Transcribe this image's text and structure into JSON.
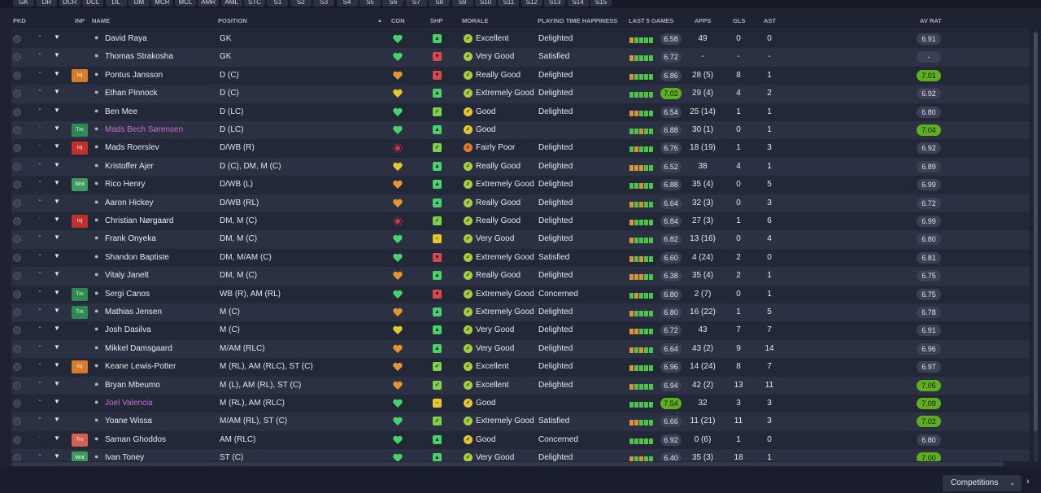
{
  "tabs": [
    "GK",
    "DR",
    "DCR",
    "DCL",
    "DL",
    "DM",
    "MCR",
    "MCL",
    "AMR",
    "AML",
    "STC",
    "S1",
    "S2",
    "S3",
    "S4",
    "S5",
    "S6",
    "S7",
    "S8",
    "S9",
    "S10",
    "S11",
    "S12",
    "S13",
    "S14",
    "S15"
  ],
  "columns": {
    "pkd": "PKD",
    "inf": "INF",
    "name": "NAME",
    "position": "POSITION",
    "con": "CON",
    "shp": "SHP",
    "morale": "MORALE",
    "happiness": "PLAYING TIME HAPPINESS",
    "last5": "LAST 5 GAMES",
    "apps": "APPS",
    "gls": "GLS",
    "ast": "AST",
    "avrat": "AV RAT"
  },
  "sort_icon": "sort-ascending-icon",
  "colors": {
    "row_odd": "#232839",
    "row_even": "#2b3042",
    "good_rating": "#5fae1e",
    "con_green": "#47d26a",
    "con_orange": "#e3962d",
    "con_yellow": "#e6c72c",
    "con_red": "#d03a3a",
    "morale_green": "#a3d33a",
    "morale_yellow": "#e6c72c",
    "morale_orange": "#e57a2c"
  },
  "players": [
    {
      "dash": "-",
      "dash_red": false,
      "inf": "",
      "inf_type": "",
      "name": "David Raya",
      "pink": false,
      "position": "GK",
      "con": "green",
      "shp": "up",
      "morale": "Excellent",
      "morale_level": "green",
      "happiness": "Delighted",
      "form": [
        "o",
        "g",
        "g",
        "g",
        "g"
      ],
      "last5": "6.58",
      "l5_good": false,
      "apps": "49",
      "gls": "0",
      "ast": "0",
      "avrat": "6.91",
      "av_good": false
    },
    {
      "dash": "-",
      "dash_red": false,
      "inf": "",
      "inf_type": "",
      "name": "Thomas Strakosha",
      "pink": false,
      "position": "GK",
      "con": "green",
      "shp": "down",
      "morale": "Very Good",
      "morale_level": "green",
      "happiness": "Satisfied",
      "form": [
        "o",
        "g",
        "g",
        "g",
        "g"
      ],
      "last5": "6.72",
      "l5_good": false,
      "apps": "-",
      "gls": "-",
      "ast": "-",
      "avrat": "-",
      "av_good": false
    },
    {
      "dash": "-",
      "dash_red": false,
      "inf": "Inj",
      "inf_type": "orange",
      "name": "Pontus Jansson",
      "pink": false,
      "position": "D (C)",
      "con": "orange",
      "shp": "down",
      "morale": "Really Good",
      "morale_level": "green",
      "happiness": "Delighted",
      "form": [
        "o",
        "g",
        "g",
        "g",
        "g"
      ],
      "last5": "6.86",
      "l5_good": false,
      "apps": "28 (5)",
      "gls": "8",
      "ast": "1",
      "avrat": "7.01",
      "av_good": true
    },
    {
      "dash": "-",
      "dash_red": false,
      "inf": "",
      "inf_type": "",
      "name": "Ethan Pinnock",
      "pink": false,
      "position": "D (C)",
      "con": "yellow",
      "shp": "up",
      "morale": "Extremely Good",
      "morale_level": "green",
      "happiness": "Delighted",
      "form": [
        "g",
        "g",
        "g",
        "g",
        "g"
      ],
      "last5": "7.02",
      "l5_good": true,
      "apps": "29 (4)",
      "gls": "4",
      "ast": "2",
      "avrat": "6.92",
      "av_good": false
    },
    {
      "dash": "-",
      "dash_red": false,
      "inf": "",
      "inf_type": "",
      "name": "Ben Mee",
      "pink": false,
      "position": "D (LC)",
      "con": "green",
      "shp": "check",
      "morale": "Good",
      "morale_level": "yellow",
      "happiness": "Delighted",
      "form": [
        "o",
        "o",
        "g",
        "g",
        "g"
      ],
      "last5": "6.54",
      "l5_good": false,
      "apps": "25 (14)",
      "gls": "1",
      "ast": "1",
      "avrat": "6.80",
      "av_good": false
    },
    {
      "dash": "-",
      "dash_red": true,
      "inf": "Tm",
      "inf_type": "tm",
      "name": "Mads Bech Sørensen",
      "pink": true,
      "position": "D (LC)",
      "con": "green",
      "shp": "up",
      "morale": "Good",
      "morale_level": "yellow",
      "happiness": "",
      "form": [
        "g",
        "g",
        "o",
        "g",
        "g"
      ],
      "last5": "6.88",
      "l5_good": false,
      "apps": "30 (1)",
      "gls": "0",
      "ast": "1",
      "avrat": "7.04",
      "av_good": true
    },
    {
      "dash": "-",
      "dash_red": true,
      "inf": "Inj",
      "inf_type": "inj",
      "name": "Mads Roerslev",
      "pink": false,
      "position": "D/WB (R)",
      "con": "red",
      "shp": "check",
      "morale": "Fairly Poor",
      "morale_level": "orange",
      "happiness": "Delighted",
      "form": [
        "g",
        "o",
        "g",
        "g",
        "g"
      ],
      "last5": "6.76",
      "l5_good": false,
      "apps": "18 (19)",
      "gls": "1",
      "ast": "3",
      "avrat": "6.92",
      "av_good": false
    },
    {
      "dash": "-",
      "dash_red": false,
      "inf": "",
      "inf_type": "",
      "name": "Kristoffer Ajer",
      "pink": false,
      "position": "D (C), DM, M (C)",
      "con": "yellow",
      "shp": "up",
      "morale": "Really Good",
      "morale_level": "green",
      "happiness": "Delighted",
      "form": [
        "o",
        "o",
        "o",
        "g",
        "g"
      ],
      "last5": "6.52",
      "l5_good": false,
      "apps": "38",
      "gls": "4",
      "ast": "1",
      "avrat": "6.89",
      "av_good": false
    },
    {
      "dash": "-",
      "dash_red": false,
      "inf": "Wnt",
      "inf_type": "wnt",
      "name": "Rico Henry",
      "pink": false,
      "position": "D/WB (L)",
      "con": "orange",
      "shp": "up",
      "morale": "Extremely Good",
      "morale_level": "green",
      "happiness": "Delighted",
      "form": [
        "g",
        "g",
        "o",
        "g",
        "g"
      ],
      "last5": "6.88",
      "l5_good": false,
      "apps": "35 (4)",
      "gls": "0",
      "ast": "5",
      "avrat": "6.99",
      "av_good": false
    },
    {
      "dash": "-",
      "dash_red": false,
      "inf": "",
      "inf_type": "",
      "name": "Aaron Hickey",
      "pink": false,
      "position": "D/WB (RL)",
      "con": "orange",
      "shp": "up",
      "morale": "Really Good",
      "morale_level": "green",
      "happiness": "Delighted",
      "form": [
        "o",
        "g",
        "o",
        "g",
        "g"
      ],
      "last5": "6.64",
      "l5_good": false,
      "apps": "32 (3)",
      "gls": "0",
      "ast": "3",
      "avrat": "6.72",
      "av_good": false
    },
    {
      "dash": "-",
      "dash_red": true,
      "inf": "Inj",
      "inf_type": "inj",
      "name": "Christian Nørgaard",
      "pink": false,
      "position": "DM, M (C)",
      "con": "red",
      "shp": "check",
      "morale": "Really Good",
      "morale_level": "green",
      "happiness": "Delighted",
      "form": [
        "o",
        "g",
        "g",
        "g",
        "g"
      ],
      "last5": "6.84",
      "l5_good": false,
      "apps": "27 (3)",
      "gls": "1",
      "ast": "6",
      "avrat": "6.99",
      "av_good": false
    },
    {
      "dash": "-",
      "dash_red": false,
      "inf": "",
      "inf_type": "",
      "name": "Frank Onyeka",
      "pink": false,
      "position": "DM, M (C)",
      "con": "green",
      "shp": "dash",
      "morale": "Very Good",
      "morale_level": "green",
      "happiness": "Delighted",
      "form": [
        "o",
        "g",
        "g",
        "g",
        "g"
      ],
      "last5": "6.82",
      "l5_good": false,
      "apps": "13 (16)",
      "gls": "0",
      "ast": "4",
      "avrat": "6.80",
      "av_good": false
    },
    {
      "dash": "-",
      "dash_red": false,
      "inf": "",
      "inf_type": "",
      "name": "Shandon Baptiste",
      "pink": false,
      "position": "DM, M/AM (C)",
      "con": "green",
      "shp": "down",
      "morale": "Extremely Good",
      "morale_level": "green",
      "happiness": "Satisfied",
      "form": [
        "o",
        "g",
        "o",
        "g",
        "g"
      ],
      "last5": "6.60",
      "l5_good": false,
      "apps": "4 (24)",
      "gls": "2",
      "ast": "0",
      "avrat": "6.81",
      "av_good": false
    },
    {
      "dash": "-",
      "dash_red": false,
      "inf": "",
      "inf_type": "",
      "name": "Vitaly Janelt",
      "pink": false,
      "position": "DM, M (C)",
      "con": "orange",
      "shp": "up",
      "morale": "Really Good",
      "morale_level": "green",
      "happiness": "Delighted",
      "form": [
        "o",
        "o",
        "o",
        "g",
        "g"
      ],
      "last5": "6.38",
      "l5_good": false,
      "apps": "35 (4)",
      "gls": "2",
      "ast": "1",
      "avrat": "6.75",
      "av_good": false
    },
    {
      "dash": "-",
      "dash_red": false,
      "inf": "Tm",
      "inf_type": "tm",
      "name": "Sergi Canos",
      "pink": false,
      "position": "WB (R), AM (RL)",
      "con": "green",
      "shp": "down",
      "morale": "Extremely Good",
      "morale_level": "green",
      "happiness": "Concerned",
      "form": [
        "g",
        "o",
        "g",
        "g",
        "g"
      ],
      "last5": "6.80",
      "l5_good": false,
      "apps": "2 (7)",
      "gls": "0",
      "ast": "1",
      "avrat": "6.75",
      "av_good": false
    },
    {
      "dash": "-",
      "dash_red": false,
      "inf": "Tm",
      "inf_type": "tm",
      "name": "Mathias Jensen",
      "pink": false,
      "position": "M (C)",
      "con": "orange",
      "shp": "up",
      "morale": "Extremely Good",
      "morale_level": "green",
      "happiness": "Delighted",
      "form": [
        "o",
        "g",
        "g",
        "g",
        "g"
      ],
      "last5": "6.80",
      "l5_good": false,
      "apps": "16 (22)",
      "gls": "1",
      "ast": "5",
      "avrat": "6.78",
      "av_good": false
    },
    {
      "dash": "-",
      "dash_red": false,
      "inf": "",
      "inf_type": "",
      "name": "Josh Dasilva",
      "pink": false,
      "position": "M (C)",
      "con": "yellow",
      "shp": "up",
      "morale": "Very Good",
      "morale_level": "green",
      "happiness": "Delighted",
      "form": [
        "o",
        "o",
        "g",
        "g",
        "g"
      ],
      "last5": "6.72",
      "l5_good": false,
      "apps": "43",
      "gls": "7",
      "ast": "7",
      "avrat": "6.91",
      "av_good": false
    },
    {
      "dash": "-",
      "dash_red": false,
      "inf": "",
      "inf_type": "",
      "name": "Mikkel Damsgaard",
      "pink": false,
      "position": "M/AM (RLC)",
      "con": "orange",
      "shp": "up",
      "morale": "Very Good",
      "morale_level": "green",
      "happiness": "Delighted",
      "form": [
        "o",
        "g",
        "o",
        "g",
        "g"
      ],
      "last5": "6.64",
      "l5_good": false,
      "apps": "43 (2)",
      "gls": "9",
      "ast": "14",
      "avrat": "6.96",
      "av_good": false
    },
    {
      "dash": "-",
      "dash_red": false,
      "inf": "Inj",
      "inf_type": "orange",
      "name": "Keane Lewis-Potter",
      "pink": false,
      "position": "M (RL), AM (RLC), ST (C)",
      "con": "orange",
      "shp": "check",
      "morale": "Excellent",
      "morale_level": "green",
      "happiness": "Delighted",
      "form": [
        "o",
        "g",
        "g",
        "g",
        "g"
      ],
      "last5": "6.96",
      "l5_good": false,
      "apps": "14 (24)",
      "gls": "8",
      "ast": "7",
      "avrat": "6.97",
      "av_good": false
    },
    {
      "dash": "-",
      "dash_red": false,
      "inf": "",
      "inf_type": "",
      "name": "Bryan Mbeumo",
      "pink": false,
      "position": "M (L), AM (RL), ST (C)",
      "con": "orange",
      "shp": "check",
      "morale": "Excellent",
      "morale_level": "green",
      "happiness": "Delighted",
      "form": [
        "o",
        "g",
        "g",
        "g",
        "g"
      ],
      "last5": "6.94",
      "l5_good": false,
      "apps": "42 (2)",
      "gls": "13",
      "ast": "11",
      "avrat": "7.05",
      "av_good": true
    },
    {
      "dash": "-",
      "dash_red": false,
      "inf": "",
      "inf_type": "",
      "name": "Joel Valencia",
      "pink": true,
      "position": "M (RL), AM (RLC)",
      "con": "green",
      "shp": "dash",
      "morale": "Good",
      "morale_level": "yellow",
      "happiness": "",
      "form": [
        "g",
        "g",
        "g",
        "g",
        "g"
      ],
      "last5": "7.54",
      "l5_good": true,
      "apps": "32",
      "gls": "3",
      "ast": "3",
      "avrat": "7.09",
      "av_good": true
    },
    {
      "dash": "-",
      "dash_red": false,
      "inf": "",
      "inf_type": "",
      "name": "Yoane Wissa",
      "pink": false,
      "position": "M/AM (RL), ST (C)",
      "con": "green",
      "shp": "check",
      "morale": "Extremely Good",
      "morale_level": "green",
      "happiness": "Satisfied",
      "form": [
        "o",
        "o",
        "g",
        "g",
        "g"
      ],
      "last5": "6.66",
      "l5_good": false,
      "apps": "11 (21)",
      "gls": "11",
      "ast": "3",
      "avrat": "7.02",
      "av_good": true
    },
    {
      "dash": "-",
      "dash_red": true,
      "inf": "Trv",
      "inf_type": "trv",
      "name": "Saman Ghoddos",
      "pink": false,
      "position": "AM (RLC)",
      "con": "green",
      "shp": "up",
      "morale": "Good",
      "morale_level": "yellow",
      "happiness": "Concerned",
      "form": [
        "g",
        "g",
        "g",
        "g",
        "g"
      ],
      "last5": "6.92",
      "l5_good": false,
      "apps": "0 (6)",
      "gls": "1",
      "ast": "0",
      "avrat": "6.80",
      "av_good": false
    },
    {
      "dash": "-",
      "dash_red": false,
      "inf": "Wnt",
      "inf_type": "wnt",
      "name": "Ivan Toney",
      "pink": false,
      "position": "ST (C)",
      "con": "green",
      "shp": "up",
      "morale": "Very Good",
      "morale_level": "green",
      "happiness": "Delighted",
      "form": [
        "o",
        "g",
        "o",
        "g",
        "g"
      ],
      "last5": "6.40",
      "l5_good": false,
      "apps": "35 (3)",
      "gls": "18",
      "ast": "1",
      "avrat": "7.00",
      "av_good": true
    }
  ],
  "footer": {
    "competitions_label": "Competitions",
    "dropdown_icon": "chevron-down-icon",
    "next_icon": "chevron-right-icon"
  }
}
